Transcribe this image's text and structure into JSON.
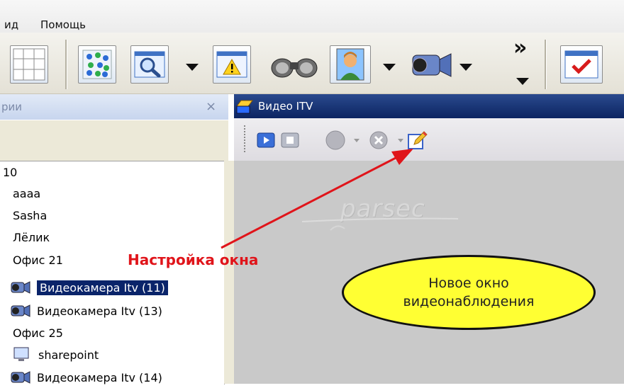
{
  "menubar": {
    "items": [
      {
        "label": "ид"
      },
      {
        "label": "Помощь"
      }
    ]
  },
  "toolbar": {
    "overflow_label": "»",
    "icons": [
      "grid-layout",
      "colored-dots",
      "magnify-window",
      "warning-window",
      "binoculars",
      "user-portrait",
      "video-camera",
      "checklist"
    ]
  },
  "left_panel": {
    "title": "рии",
    "close_label": "×",
    "tree": [
      {
        "label": "10",
        "icon": "none"
      },
      {
        "label": "аааа",
        "icon": "none"
      },
      {
        "label": "Sasha",
        "icon": "none"
      },
      {
        "label": "Лёлик",
        "icon": "none"
      },
      {
        "label": "Офис 21",
        "icon": "none"
      },
      {
        "label": "Видеокамера Itv (11)",
        "icon": "camera",
        "selected": true
      },
      {
        "label": "Видеокамера Itv (13)",
        "icon": "camera"
      },
      {
        "label": "Офис 25",
        "icon": "none"
      },
      {
        "label": "sharepoint",
        "icon": "monitor"
      },
      {
        "label": "Видеокамера Itv (14)",
        "icon": "camera"
      }
    ]
  },
  "video_window": {
    "title": "Видео ITV",
    "watermark": "parsec",
    "toolbar_icons": [
      "play",
      "stop",
      "record",
      "dropdown",
      "close",
      "dropdown",
      "edit-settings"
    ]
  },
  "annotations": {
    "arrow_label": "Настройка окна",
    "oval_line1": "Новое окно",
    "oval_line2": "видеонаблюдения"
  },
  "colors": {
    "title_bar": "#0c2461",
    "selection": "#0a246a",
    "annotation_red": "#e0141a",
    "oval_fill": "#ffff33"
  }
}
